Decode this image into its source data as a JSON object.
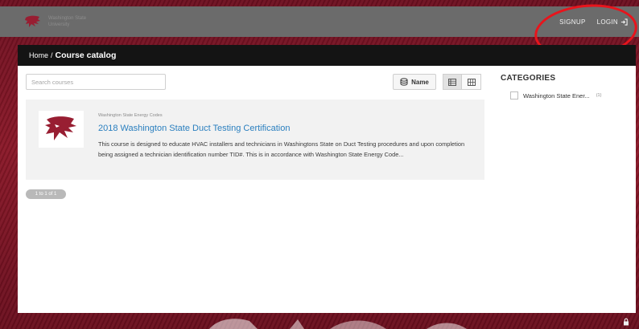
{
  "header": {
    "logo_text": "Washington State University",
    "signup_label": "SIGNUP",
    "login_label": "LOGIN"
  },
  "breadcrumb": {
    "home": "Home",
    "separator": "/",
    "current": "Course catalog"
  },
  "toolbar": {
    "search_placeholder": "Search courses",
    "sort_label": "Name",
    "list_view_icon": "list-view-icon",
    "grid_view_icon": "grid-view-icon"
  },
  "course": {
    "category": "Washington State Energy Codes",
    "title": "2018 Washington State Duct Testing Certification",
    "description": "This course is designed to educate HVAC installers and technicians in Washingtons State on Duct Testing procedures and upon completion being assigned a technician identification number TID#. This is in accordance with Washington State Energy Code..."
  },
  "pagination": {
    "label": "1 to 1 of 1"
  },
  "sidebar": {
    "title": "CATEGORIES",
    "categories": [
      {
        "label": "Washington State Ener...",
        "count": "(1)"
      }
    ]
  },
  "colors": {
    "brand": "#981e32",
    "link": "#2a7fbf",
    "annotation": "#e8141c"
  }
}
